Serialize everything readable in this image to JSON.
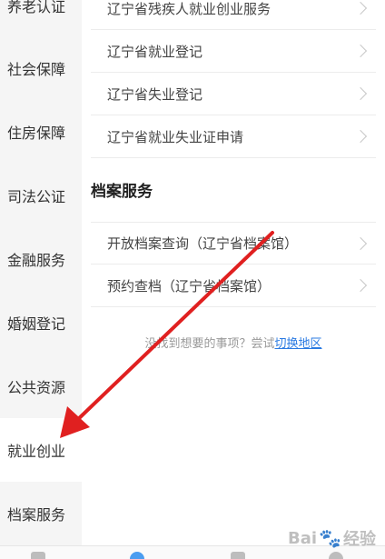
{
  "sidebar": {
    "items": [
      {
        "label": "养老认证"
      },
      {
        "label": "社会保障"
      },
      {
        "label": "住房保障"
      },
      {
        "label": "司法公证"
      },
      {
        "label": "金融服务"
      },
      {
        "label": "婚姻登记"
      },
      {
        "label": "公共资源"
      },
      {
        "label": "就业创业"
      },
      {
        "label": "档案服务"
      }
    ],
    "active_index": 7
  },
  "main": {
    "employment_items": [
      {
        "label": "辽宁省残疾人就业创业服务"
      },
      {
        "label": "辽宁省就业登记"
      },
      {
        "label": "辽宁省失业登记"
      },
      {
        "label": "辽宁省就业失业证申请"
      }
    ],
    "archive_section_title": "档案服务",
    "archive_items": [
      {
        "label": "开放档案查询（辽宁省档案馆）"
      },
      {
        "label": "预约查档（辽宁省档案馆）"
      }
    ],
    "hint_text": "没找到想要的事项？尝试",
    "hint_link": "切换地区"
  },
  "watermark": {
    "text_left": "Bai",
    "text_right": "经验"
  },
  "colors": {
    "accent": "#2a7ae2",
    "arrow": "#e02020",
    "sidebar_bg": "#f5f5f5"
  }
}
